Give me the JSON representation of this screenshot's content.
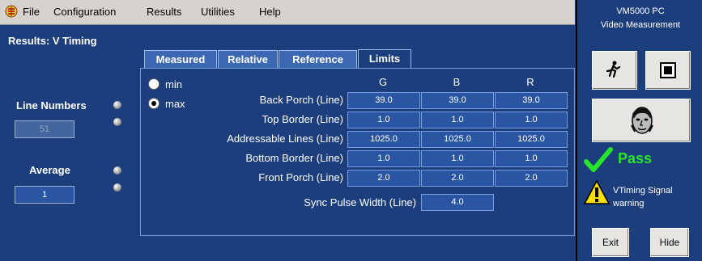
{
  "menubar": {
    "app_icon": "tektronix-logo-icon",
    "items": [
      "File",
      "Configuration",
      "Results",
      "Utilities",
      "Help"
    ]
  },
  "left": {
    "title": "Results: V Timing",
    "line_numbers_label": "Line Numbers",
    "line_numbers_value": "51",
    "average_label": "Average",
    "average_value": "1"
  },
  "tabs": [
    "Measured",
    "Relative",
    "Reference",
    "Limits"
  ],
  "active_tab": "Limits",
  "options": {
    "min_label": "min",
    "max_label": "max",
    "selected": "max"
  },
  "table": {
    "columns": [
      "G",
      "B",
      "R"
    ],
    "rows": [
      {
        "label": "Back Porch (Line)",
        "values": [
          "39.0",
          "39.0",
          "39.0"
        ]
      },
      {
        "label": "Top Border (Line)",
        "values": [
          "1.0",
          "1.0",
          "1.0"
        ]
      },
      {
        "label": "Addressable Lines (Line)",
        "values": [
          "1025.0",
          "1025.0",
          "1025.0"
        ]
      },
      {
        "label": "Bottom Border (Line)",
        "values": [
          "1.0",
          "1.0",
          "1.0"
        ]
      },
      {
        "label": "Front Porch (Line)",
        "values": [
          "2.0",
          "2.0",
          "2.0"
        ]
      }
    ],
    "sync_label": "Sync Pulse Width (Line)",
    "sync_value": "4.0"
  },
  "right": {
    "title_line1": "VM5000 PC",
    "title_line2": "Video Measurement",
    "run_icon": "running-man-icon",
    "stop_icon": "stop-square-icon",
    "face_icon": "face-image-icon",
    "pass_icon": "green-checkmark-icon",
    "pass_label": "Pass",
    "warning_icon": "warning-triangle-icon",
    "warning_line1": "VTiming Signal",
    "warning_line2": "warning",
    "exit_label": "Exit",
    "hide_label": "Hide"
  },
  "colors": {
    "background": "#1c3e7c",
    "cell": "#2a55a3",
    "pass": "#27e52a",
    "menubar": "#d6d3ce"
  }
}
